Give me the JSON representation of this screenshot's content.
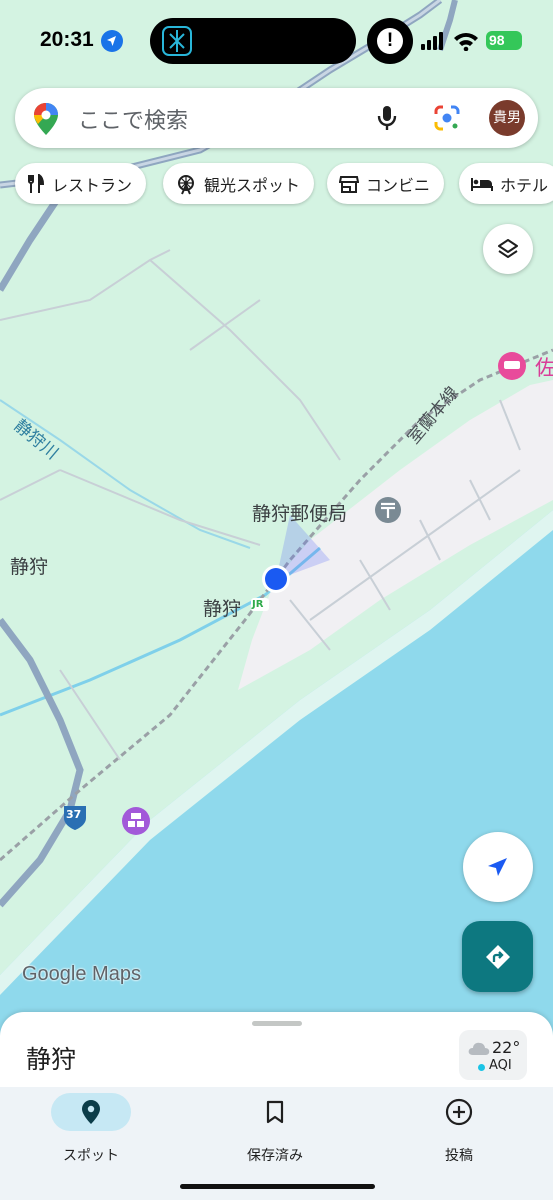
{
  "status_bar": {
    "time": "20:31",
    "battery": "98"
  },
  "search": {
    "placeholder": "ここで検索",
    "avatar_text": "貴男"
  },
  "chips": [
    {
      "label": "レストラン",
      "icon": "restaurant-icon"
    },
    {
      "label": "観光スポット",
      "icon": "ferris-wheel-icon"
    },
    {
      "label": "コンビニ",
      "icon": "store-icon"
    },
    {
      "label": "ホテル",
      "icon": "bed-icon"
    }
  ],
  "map": {
    "labels": {
      "river": "静狩川",
      "area": "静狩",
      "rail_line": "室蘭本線",
      "post_office": "静狩郵便局",
      "station": "静狩",
      "station_badge": "JR",
      "hotel_partial": "佐",
      "route_shield": "37"
    },
    "colors": {
      "land": "#d4f3e2",
      "water": "#8fd9ec",
      "town": "#f1f0f3",
      "road": "#8fa6c0",
      "location_dot": "#1a5af2"
    },
    "attribution": "Google Maps"
  },
  "bottom_sheet": {
    "title": "静狩",
    "weather": {
      "temperature": "22°",
      "aqi_label": "AQI",
      "icon": "cloud-icon"
    }
  },
  "nav": [
    {
      "label": "スポット",
      "icon": "location-pin-icon",
      "active": true
    },
    {
      "label": "保存済み",
      "icon": "bookmark-icon",
      "active": false
    },
    {
      "label": "投稿",
      "icon": "add-circle-icon",
      "active": false
    }
  ]
}
